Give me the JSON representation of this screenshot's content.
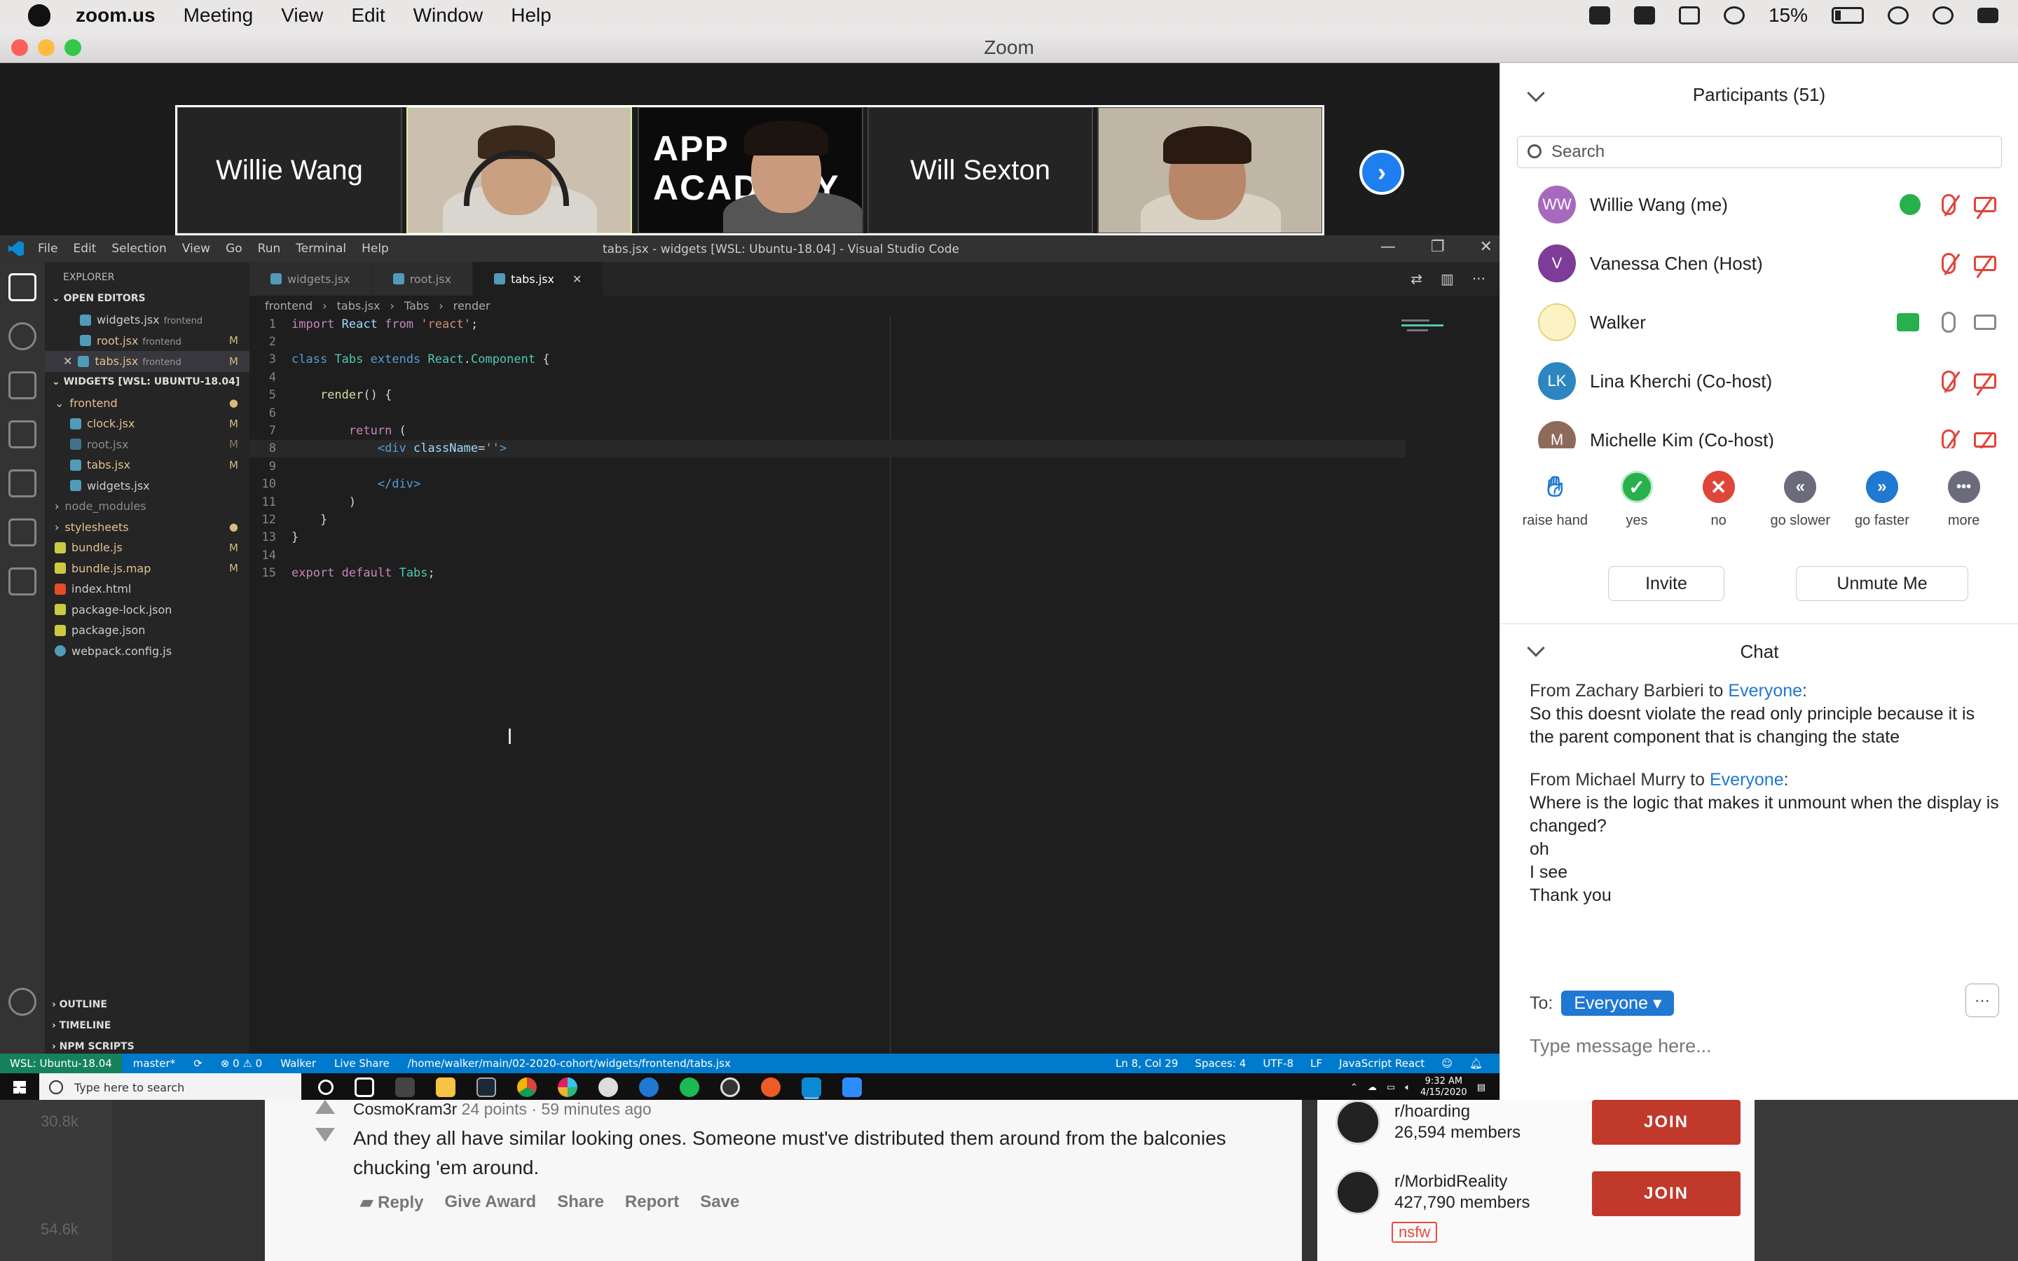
{
  "menubar": {
    "app": "zoom.us",
    "items": [
      "Meeting",
      "View",
      "Edit",
      "Window",
      "Help"
    ],
    "battery": "15%"
  },
  "window": {
    "title": "Zoom"
  },
  "video_strip": {
    "tiles": [
      {
        "name": "Willie Wang",
        "type": "name"
      },
      {
        "name": "",
        "type": "video"
      },
      {
        "name": "",
        "type": "video"
      },
      {
        "name": "Will Sexton",
        "type": "name"
      },
      {
        "name": "",
        "type": "video"
      }
    ],
    "next_icon": "chevron-right-icon",
    "logo_text": "APP ACADEMY"
  },
  "vscode": {
    "menu": [
      "File",
      "Edit",
      "Selection",
      "View",
      "Go",
      "Run",
      "Terminal",
      "Help"
    ],
    "title": "tabs.jsx - widgets [WSL: Ubuntu-18.04] - Visual Studio Code",
    "explorer_label": "EXPLORER",
    "open_editors_label": "OPEN EDITORS",
    "open_editors": [
      {
        "name": "widgets.jsx",
        "tag": "frontend",
        "status": ""
      },
      {
        "name": "root.jsx",
        "tag": "frontend",
        "status": "M"
      },
      {
        "name": "tabs.jsx",
        "tag": "frontend",
        "status": "M"
      }
    ],
    "workspace_label": "WIDGETS [WSL: UBUNTU-18.04]",
    "tree": [
      {
        "name": "frontend",
        "status": "●",
        "kind": "folder-open"
      },
      {
        "name": "clock.jsx",
        "status": "M",
        "kind": "file"
      },
      {
        "name": "root.jsx",
        "status": "M",
        "kind": "file"
      },
      {
        "name": "tabs.jsx",
        "status": "M",
        "kind": "file"
      },
      {
        "name": "widgets.jsx",
        "status": "",
        "kind": "file"
      },
      {
        "name": "node_modules",
        "status": "",
        "kind": "folder"
      },
      {
        "name": "stylesheets",
        "status": "●",
        "kind": "folder"
      },
      {
        "name": "bundle.js",
        "status": "M",
        "kind": "js"
      },
      {
        "name": "bundle.js.map",
        "status": "M",
        "kind": "js"
      },
      {
        "name": "index.html",
        "status": "",
        "kind": "html"
      },
      {
        "name": "package-lock.json",
        "status": "",
        "kind": "json"
      },
      {
        "name": "package.json",
        "status": "",
        "kind": "json"
      },
      {
        "name": "webpack.config.js",
        "status": "",
        "kind": "cfg"
      }
    ],
    "bottom_sections": [
      "OUTLINE",
      "TIMELINE",
      "NPM SCRIPTS"
    ],
    "tabs": [
      "widgets.jsx",
      "root.jsx",
      "tabs.jsx"
    ],
    "breadcrumb": [
      "frontend",
      "tabs.jsx",
      "Tabs",
      "render"
    ],
    "code": [
      "import React from 'react';",
      "",
      "class Tabs extends React.Component {",
      "",
      "    render() {",
      "",
      "        return (",
      "            <div className=''>",
      "",
      "            </div>",
      "        )",
      "    }",
      "}",
      "",
      "export default Tabs;"
    ],
    "status": {
      "remote": "WSL: Ubuntu-18.04",
      "branch": "master*",
      "problems": "⊗ 0 ⚠ 0",
      "user": "Walker",
      "live_share": "Live Share",
      "path": "/home/walker/main/02-2020-cohort/widgets/frontend/tabs.jsx",
      "position": "Ln 8, Col 29",
      "spaces": "Spaces: 4",
      "encoding": "UTF-8",
      "eol": "LF",
      "language": "JavaScript React"
    }
  },
  "taskbar": {
    "search_placeholder": "Type here to search",
    "time": "9:32 AM",
    "date": "4/15/2020"
  },
  "participants": {
    "title": "Participants (51)",
    "search_placeholder": "Search",
    "list": [
      {
        "initials": "WW",
        "name": "Willie Wang (me)",
        "color": "#9b59b6"
      },
      {
        "initials": "V",
        "name": "Vanessa Chen (Host)",
        "color": "#7d3c98"
      },
      {
        "initials": "",
        "name": "Walker",
        "color": "#f5e6a8"
      },
      {
        "initials": "LK",
        "name": "Lina Kherchi (Co-host)",
        "color": "#2e86c1"
      },
      {
        "initials": "M",
        "name": "Michelle Kim (Co-host)",
        "color": "#8e6a5a"
      }
    ],
    "reactions": [
      {
        "label": "raise hand",
        "icon": "raise-hand-icon",
        "color": "#1f78d1"
      },
      {
        "label": "yes",
        "icon": "check-icon",
        "color": "#26b14c"
      },
      {
        "label": "no",
        "icon": "x-icon",
        "color": "#e0453a"
      },
      {
        "label": "go slower",
        "icon": "rewind-icon",
        "color": "#6b6b7b"
      },
      {
        "label": "go faster",
        "icon": "fast-forward-icon",
        "color": "#1f78d1"
      },
      {
        "label": "more",
        "icon": "more-icon",
        "color": "#6b6b7b"
      }
    ],
    "invite": "Invite",
    "unmute": "Unmute Me"
  },
  "chat": {
    "title": "Chat",
    "messages": [
      {
        "from": "From Zachary Barbieri to ",
        "to": "Everyone",
        "lines": [
          "So this doesnt violate the read only principle because it is the parent component that is changing the state"
        ]
      },
      {
        "from": "From Michael Murry to ",
        "to": "Everyone",
        "lines": [
          "Where is the logic that makes it unmount when the display is changed?",
          "oh",
          "I see",
          "Thank you"
        ]
      }
    ],
    "to_label": "To:",
    "to_value": "Everyone ▾",
    "more": "···",
    "input_placeholder": "Type message here..."
  },
  "reddit": {
    "votes_left": [
      "30.8k",
      "54.6k"
    ],
    "comment_user": "CosmoKram3r",
    "comment_meta": " 24 points · 59 minutes ago",
    "comment_text": "And they all have similar looking ones. Someone must've distributed them around from the balconies chucking 'em around.",
    "actions": [
      "Reply",
      "Give Award",
      "Share",
      "Report",
      "Save"
    ],
    "communities": [
      {
        "name": "r/hoarding",
        "members": "26,594 members",
        "join": "JOIN"
      },
      {
        "name": "r/MorbidReality",
        "members": "427,790 members",
        "join": "JOIN"
      }
    ],
    "nsfw": "nsfw"
  }
}
